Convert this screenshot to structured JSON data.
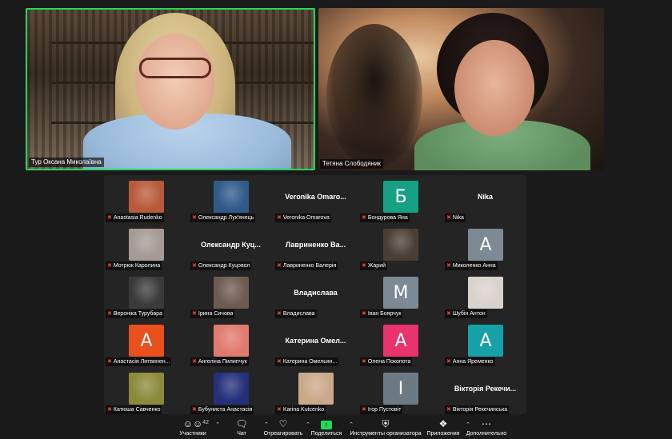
{
  "speakers": [
    {
      "name": "Тур Оксана Миколаївна"
    },
    {
      "name": "Тетяна Слободяник"
    }
  ],
  "gallery": [
    {
      "label": "Anastasia Rudenko",
      "thumb": "photo",
      "color": "#b85a3a"
    },
    {
      "label": "Олександр Лук'янець",
      "thumb": "photo",
      "color": "#2f5a8a"
    },
    {
      "label": "Veronika Omarova",
      "thumb": "name",
      "display": "Veronika  Omaro..."
    },
    {
      "label": "Бондурова Яна",
      "thumb": "letter",
      "letter": "Б",
      "color": "#16a085"
    },
    {
      "label": "Nika",
      "thumb": "name",
      "display": "Nika"
    },
    {
      "label": "Мотрюк Каролина",
      "thumb": "photo",
      "color": "#a59a94"
    },
    {
      "label": "Олександр Куцовол",
      "thumb": "name",
      "display": "Олександр  Куц..."
    },
    {
      "label": "Лавриненко Валерія",
      "thumb": "name",
      "display": "Лавриненко  Ва..."
    },
    {
      "label": "Жарий",
      "thumb": "photo",
      "color": "#4a3e34"
    },
    {
      "label": "Миколенко Анна",
      "thumb": "letter",
      "letter": "А",
      "color": "#7d8a96"
    },
    {
      "label": "Вероніка Турубара",
      "thumb": "photo",
      "color": "#3a3a3a"
    },
    {
      "label": "Ірина Сичова",
      "thumb": "photo",
      "color": "#6e5a50"
    },
    {
      "label": "Владислава",
      "thumb": "name",
      "display": "Владислава"
    },
    {
      "label": "Іван Боярчук",
      "thumb": "letter",
      "letter": "М",
      "color": "#7d8a96"
    },
    {
      "label": "Шубін Антон",
      "thumb": "photo",
      "color": "#d9d2cc"
    },
    {
      "label": "Анастасія Литвинен...",
      "thumb": "letter",
      "letter": "А",
      "color": "#e8501d"
    },
    {
      "label": "Ангеліна Пилипчук",
      "thumb": "photo",
      "color": "#e07a6e"
    },
    {
      "label": "Катерина Омельян...",
      "thumb": "name",
      "display": "Катерина  Омел..."
    },
    {
      "label": "Олена Покопота",
      "thumb": "letter",
      "letter": "А",
      "color": "#e8336c"
    },
    {
      "label": "Анна Яременко",
      "thumb": "letter",
      "letter": "А",
      "color": "#16a0a8"
    },
    {
      "label": "Катюша Савченко",
      "thumb": "photo",
      "color": "#8b8a3a"
    },
    {
      "label": "Бубуниста Анастасія",
      "thumb": "photo",
      "color": "#23307a"
    },
    {
      "label": "Karina Kutcenko",
      "thumb": "photo",
      "color": "#caa88a"
    },
    {
      "label": "Ігор Пустовіт",
      "thumb": "letter",
      "letter": "І",
      "color": "#6c7a86"
    },
    {
      "label": "Вікторія Рекечинська",
      "thumb": "name",
      "display": "Вікторія  Рекечи..."
    }
  ],
  "toolbar": {
    "participants_label": "Участники",
    "participants_count": "42",
    "chat_label": "Чат",
    "react_label": "Отреагировать",
    "share_label": "Поделиться",
    "host_tools_label": "Инструменты организатора",
    "apps_label": "Приложения",
    "more_label": "Дополнительно"
  }
}
